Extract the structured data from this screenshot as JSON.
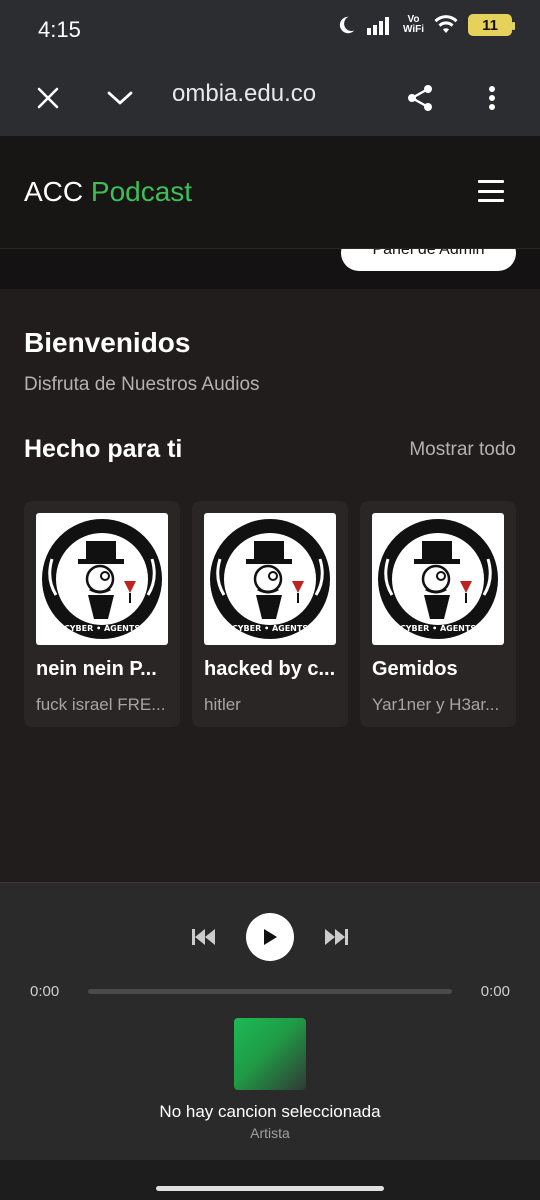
{
  "status": {
    "time": "4:15",
    "vowifi_top": "Vo",
    "vowifi_bottom": "WiFi",
    "battery": "11"
  },
  "browser": {
    "url": "ombia.edu.co"
  },
  "site": {
    "brand_main": "ACC",
    "brand_accent": "Podcast",
    "accent_color": "#3cbf56",
    "admin_button": "Panel de Admin"
  },
  "welcome": {
    "title": "Bienvenidos",
    "subtitle": "Disfruta de Nuestros Audios"
  },
  "section": {
    "title": "Hecho para ti",
    "show_all": "Mostrar todo"
  },
  "cards": [
    {
      "title": "nein nein P...",
      "subtitle": "fuck israel FRE...",
      "cover_text": "CYBER • AGENTS"
    },
    {
      "title": "hacked by c...",
      "subtitle": "hitler",
      "cover_text": "CYBER • AGENTS"
    },
    {
      "title": "Gemidos",
      "subtitle": "Yar1ner y H3ar...",
      "cover_text": "CYBER • AGENTS"
    }
  ],
  "player": {
    "current_time": "0:00",
    "total_time": "0:00",
    "progress_fraction": 0,
    "track_title": "No hay cancion seleccionada",
    "artist": "Artista"
  }
}
